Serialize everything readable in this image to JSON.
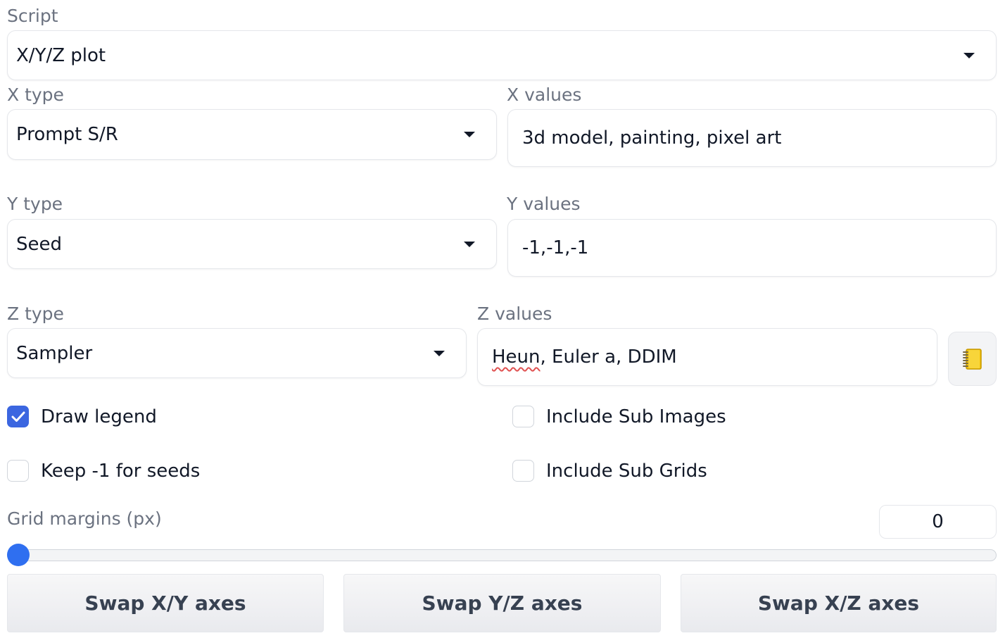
{
  "script": {
    "label": "Script",
    "value": "X/Y/Z plot"
  },
  "x": {
    "type_label": "X type",
    "type_value": "Prompt S/R",
    "values_label": "X values",
    "values": "3d model, painting, pixel art"
  },
  "y": {
    "type_label": "Y type",
    "type_value": "Seed",
    "values_label": "Y values",
    "values": "-1,-1,-1"
  },
  "z": {
    "type_label": "Z type",
    "type_value": "Sampler",
    "values_label": "Z values",
    "values_first": "Heun",
    "values_rest": ", Euler a, DDIM"
  },
  "checkboxes": {
    "draw_legend": {
      "label": "Draw legend",
      "checked": true
    },
    "include_sub_images": {
      "label": "Include Sub Images",
      "checked": false
    },
    "keep_seeds": {
      "label": "Keep -1 for seeds",
      "checked": false
    },
    "include_sub_grids": {
      "label": "Include Sub Grids",
      "checked": false
    }
  },
  "grid_margins": {
    "label": "Grid margins (px)",
    "value": "0"
  },
  "buttons": {
    "swap_xy": "Swap X/Y axes",
    "swap_yz": "Swap Y/Z axes",
    "swap_xz": "Swap X/Z axes"
  },
  "colors": {
    "accent": "#3b66e0",
    "slider": "#2f6ff0"
  }
}
